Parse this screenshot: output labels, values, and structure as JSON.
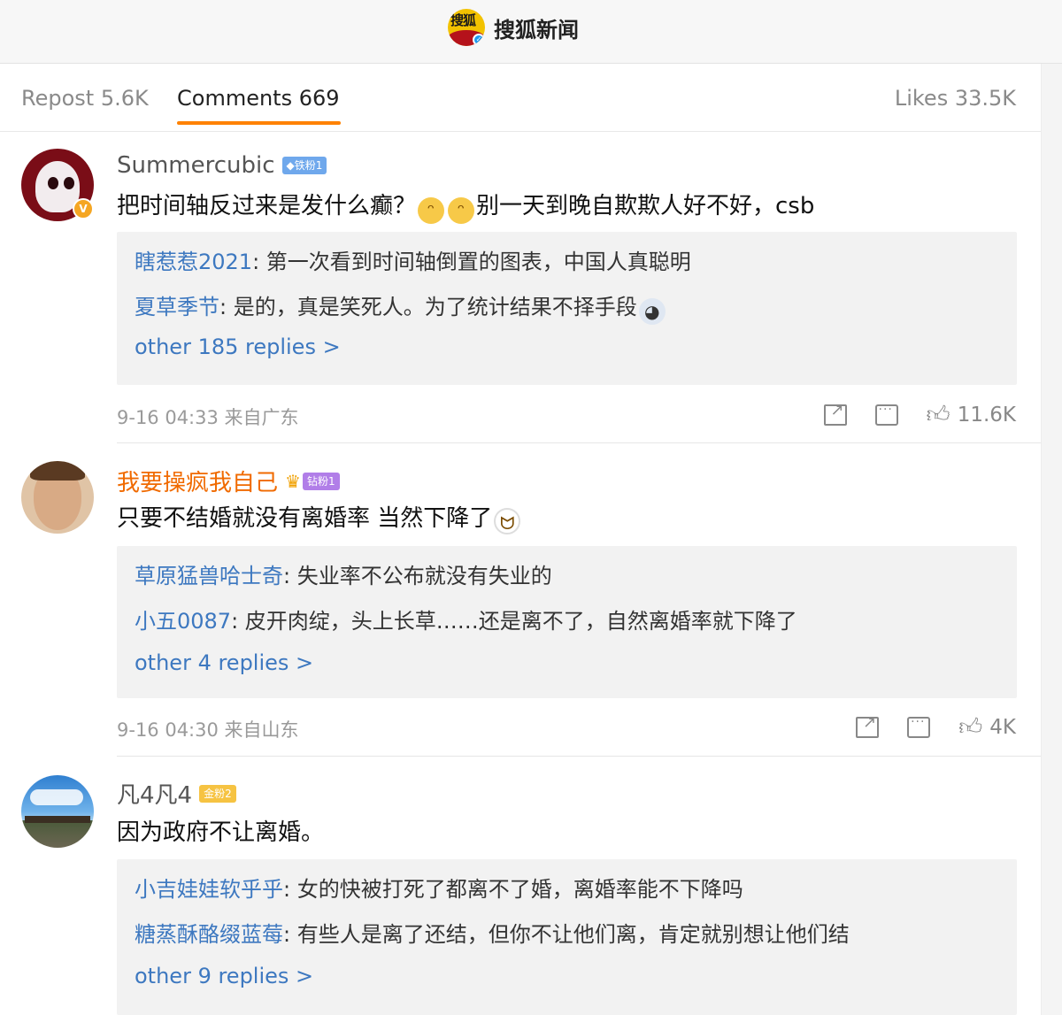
{
  "header": {
    "brand_logo_text": "搜狐",
    "brand_name": "搜狐新闻"
  },
  "tabs": {
    "repost": "Repost 5.6K",
    "comments": "Comments 669",
    "likes": "Likes 33.5K"
  },
  "comments": [
    {
      "username": "Summercubic",
      "fan_badge": "◆铁粉1",
      "text": "把时间轴反过来是发什么癫？",
      "text_after_emoji": "别一天到晚自欺欺人好不好，csb",
      "replies": [
        {
          "name": "瞎惹惹2021",
          "text": ": 第一次看到时间轴倒置的图表，中国人真聪明"
        },
        {
          "name": "夏草季节",
          "text": ": 是的，真是笑死人。为了统计结果不择手段"
        }
      ],
      "more": "other 185 replies >",
      "meta": "9-16 04:33 来自广东",
      "likes": "11.6K"
    },
    {
      "username": "我要操疯我自己",
      "fan_badge": "钻粉1",
      "text": "只要不结婚就没有离婚率 当然下降了",
      "replies": [
        {
          "name": "草原猛兽哈士奇",
          "text": ": 失业率不公布就没有失业的"
        },
        {
          "name": "小五0087",
          "text": ": 皮开肉绽，头上长草……还是离不了，自然离婚率就下降了"
        }
      ],
      "more": "other 4 replies >",
      "meta": "9-16 04:30 来自山东",
      "likes": "4K"
    },
    {
      "username": "凡4凡4",
      "fan_badge": "金粉2",
      "text": "因为政府不让离婚。",
      "replies": [
        {
          "name": "小吉娃娃软乎乎",
          "text": ": 女的快被打死了都离不了婚，离婚率能不下降吗"
        },
        {
          "name": "糖蒸酥酪缀蓝莓",
          "text": ": 有些人是离了还结，但你不让他们离，肯定就别想让他们结"
        }
      ],
      "more": "other 9 replies >"
    }
  ]
}
